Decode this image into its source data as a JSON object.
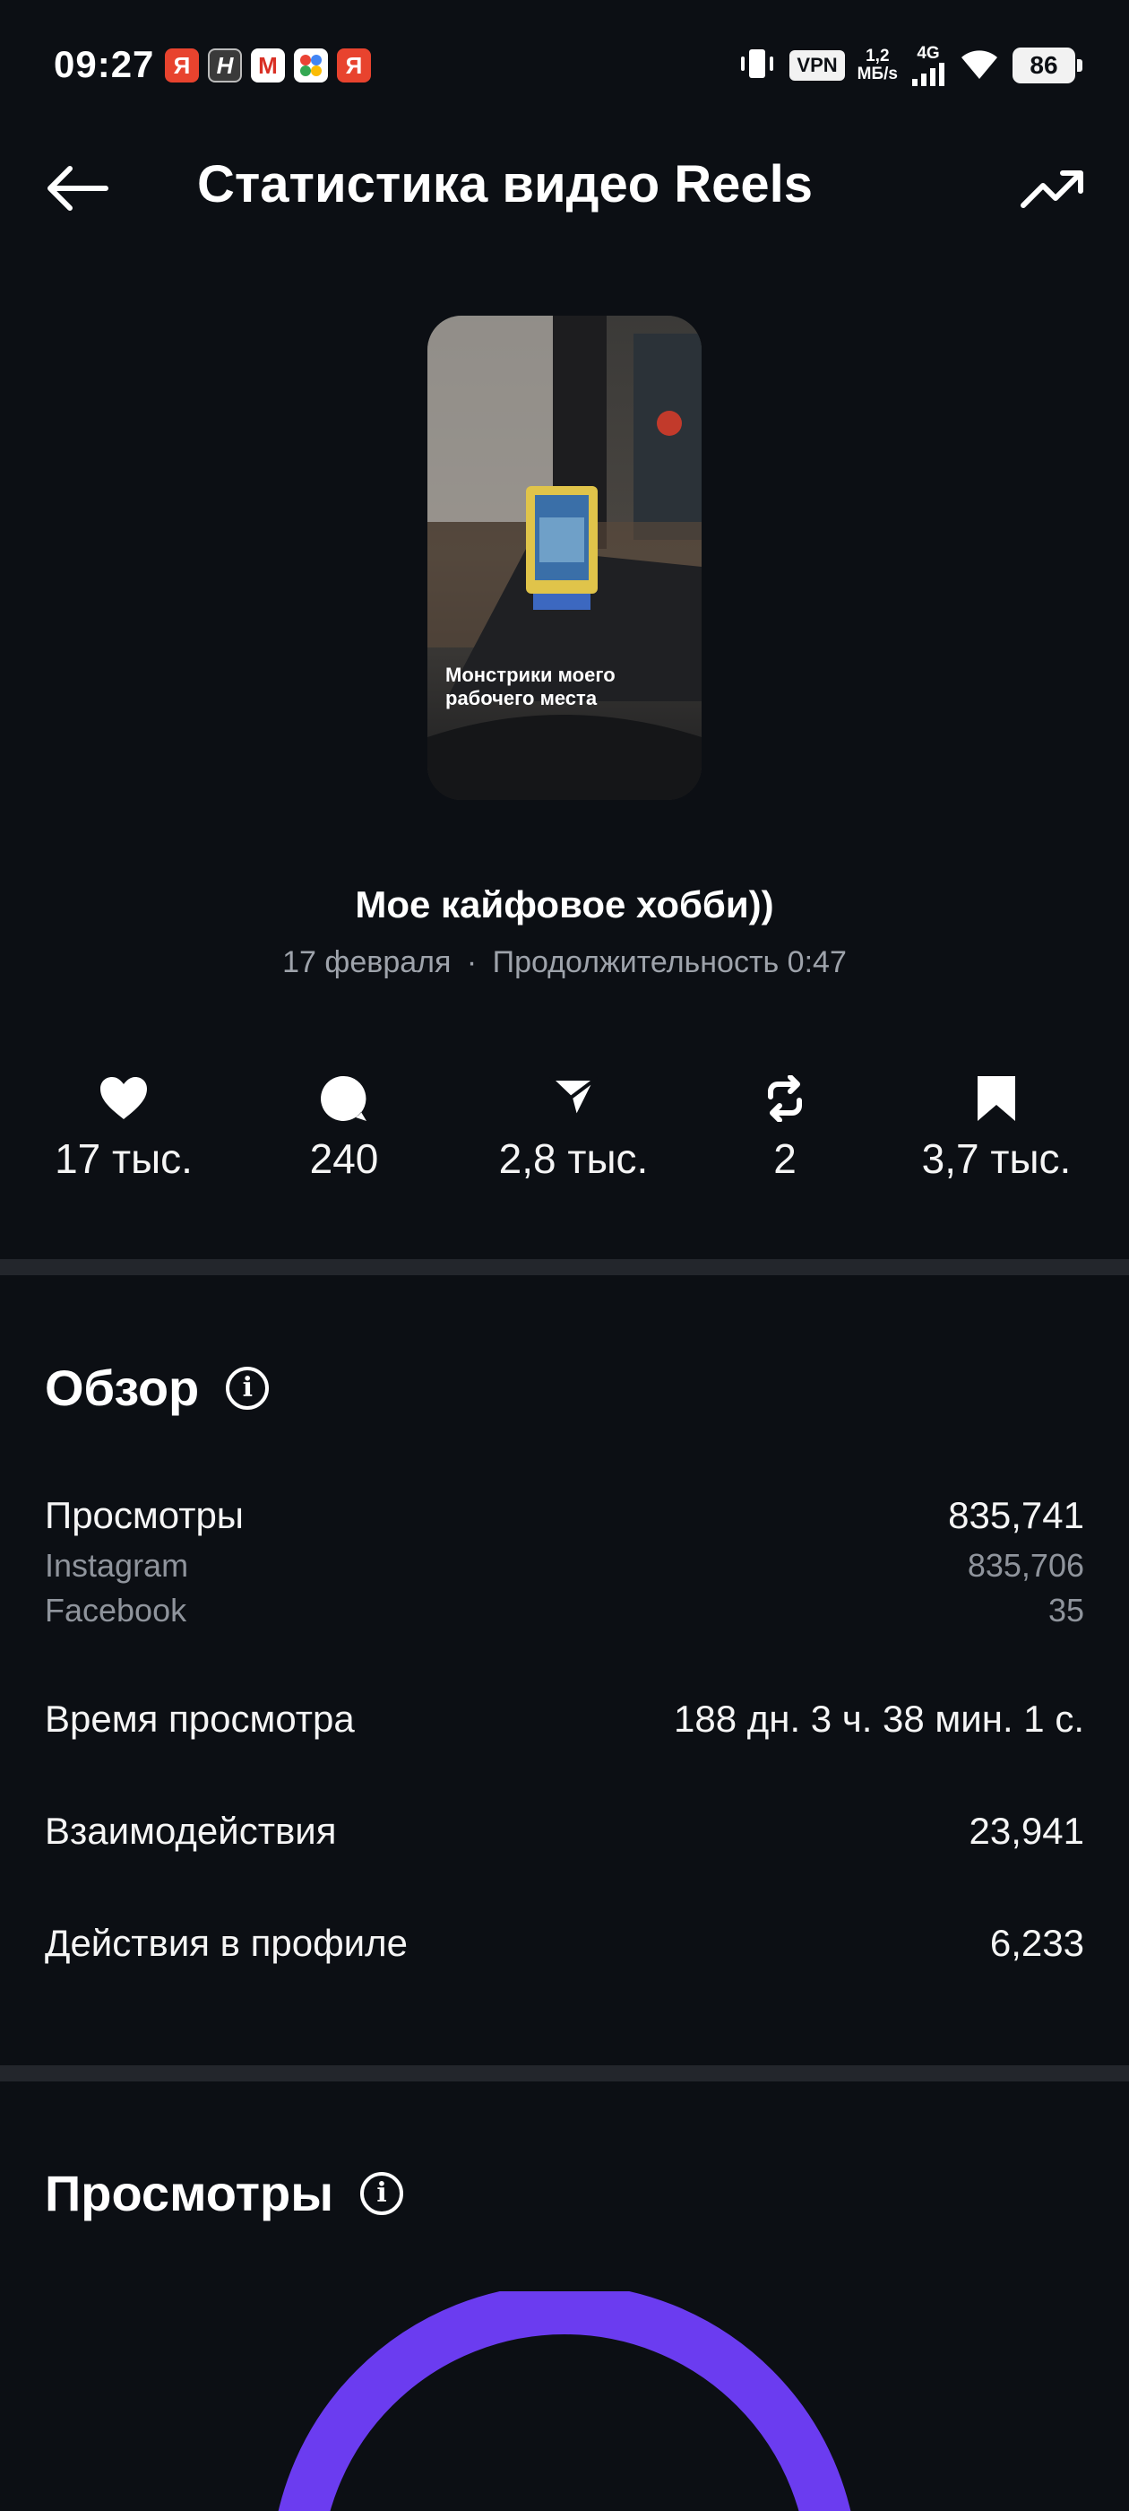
{
  "status_bar": {
    "time": "09:27",
    "notifications": [
      {
        "icon": "yandex-icon",
        "glyph": "Я",
        "color": "#e8432e"
      },
      {
        "icon": "h-app-icon",
        "glyph": "H",
        "color": "#3a3a3a"
      },
      {
        "icon": "gmail-icon",
        "glyph": "M",
        "color": "#ffffff"
      },
      {
        "icon": "dots-app-icon",
        "glyph": "",
        "color": "#ffffff"
      },
      {
        "icon": "yandex-icon",
        "glyph": "Я",
        "color": "#e8432e"
      }
    ],
    "vpn": "VPN",
    "speed_value": "1,2",
    "speed_unit": "МБ/s",
    "network": "4G",
    "battery": "86"
  },
  "header": {
    "title": "Статистика видео Reels"
  },
  "reel": {
    "thumbnail_caption": "Монстрики моего рабочего места",
    "title": "Мое кайфовое хобби))",
    "date": "17 февраля",
    "separator": "·",
    "duration": "Продолжительность 0:47"
  },
  "stats": [
    {
      "icon": "heart-icon",
      "value": "17 тыс."
    },
    {
      "icon": "comment-icon",
      "value": "240"
    },
    {
      "icon": "send-icon",
      "value": "2,8 тыс."
    },
    {
      "icon": "repost-icon",
      "value": "2"
    },
    {
      "icon": "bookmark-icon",
      "value": "3,7 тыс."
    }
  ],
  "overview": {
    "title": "Обзор",
    "views_label": "Просмотры",
    "views_value": "835,741",
    "instagram_label": "Instagram",
    "instagram_value": "835,706",
    "facebook_label": "Facebook",
    "facebook_value": "35",
    "watch_time_label": "Время просмотра",
    "watch_time_value": "188 дн. 3 ч. 38 мин. 1 с.",
    "interactions_label": "Взаимодействия",
    "interactions_value": "23,941",
    "profile_actions_label": "Действия в профиле",
    "profile_actions_value": "6,233"
  },
  "views_section": {
    "title": "Просмотры",
    "gauge_color": "#6b3cf0"
  },
  "colors": {
    "background": "#0c0f14",
    "divider": "#23262c",
    "secondary_text": "#8f949c",
    "accent": "#6b3cf0"
  }
}
